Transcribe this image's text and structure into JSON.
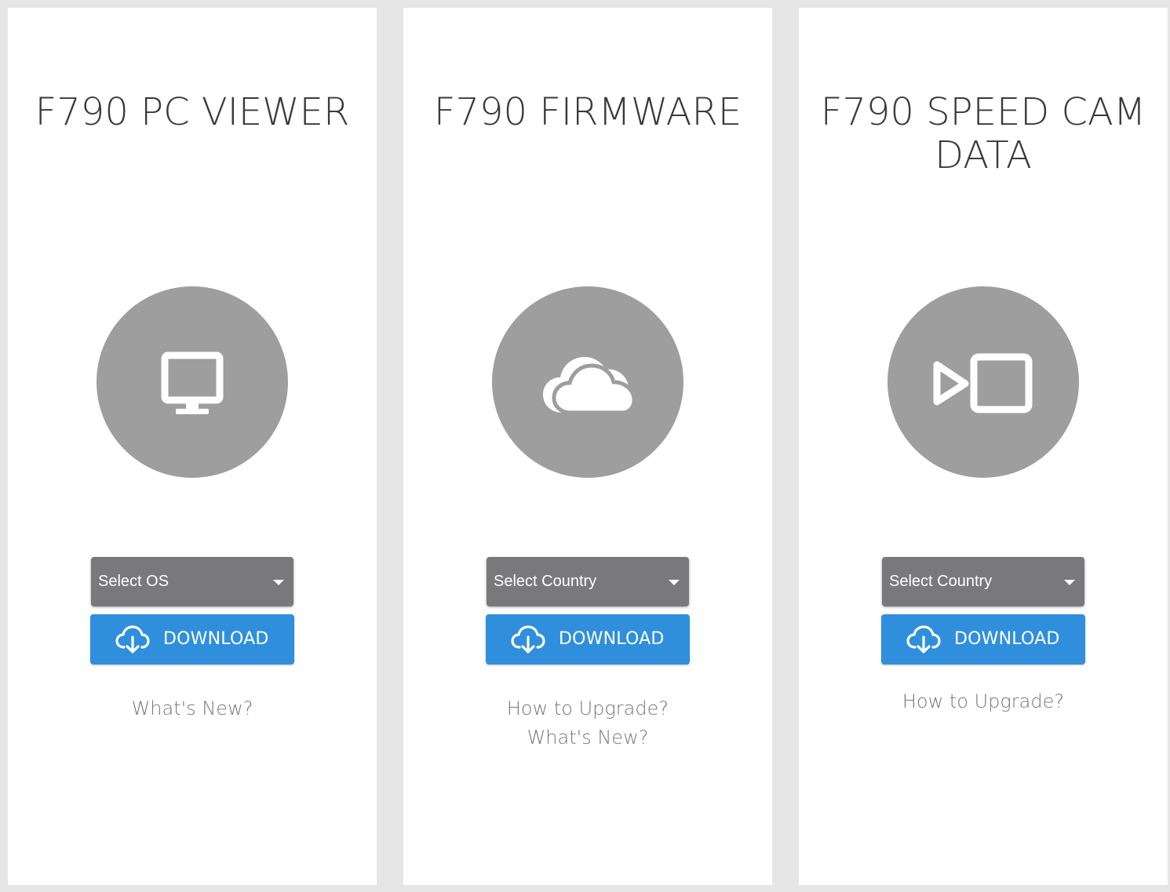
{
  "cards": [
    {
      "title": "F790 PC VIEWER",
      "icon": "monitor-icon",
      "select_label": "Select OS",
      "download_label": "DOWNLOAD",
      "links": [
        "What's New?"
      ]
    },
    {
      "title": "F790 FIRMWARE",
      "icon": "cloud-icon",
      "select_label": "Select Country",
      "download_label": "DOWNLOAD",
      "links": [
        "How to Upgrade?",
        "What's New?"
      ]
    },
    {
      "title": "F790 SPEED CAM DATA",
      "icon": "video-camera-icon",
      "select_label": "Select Country",
      "download_label": "DOWNLOAD",
      "links": [
        "How to Upgrade?"
      ]
    }
  ],
  "colors": {
    "page_background": "#e6e6e6",
    "card_background": "#ffffff",
    "icon_circle": "#9e9e9e",
    "select_background": "#79797b",
    "download_button": "#2f8fdd",
    "link_text": "#777777",
    "title_text": "#3a3a3a"
  }
}
